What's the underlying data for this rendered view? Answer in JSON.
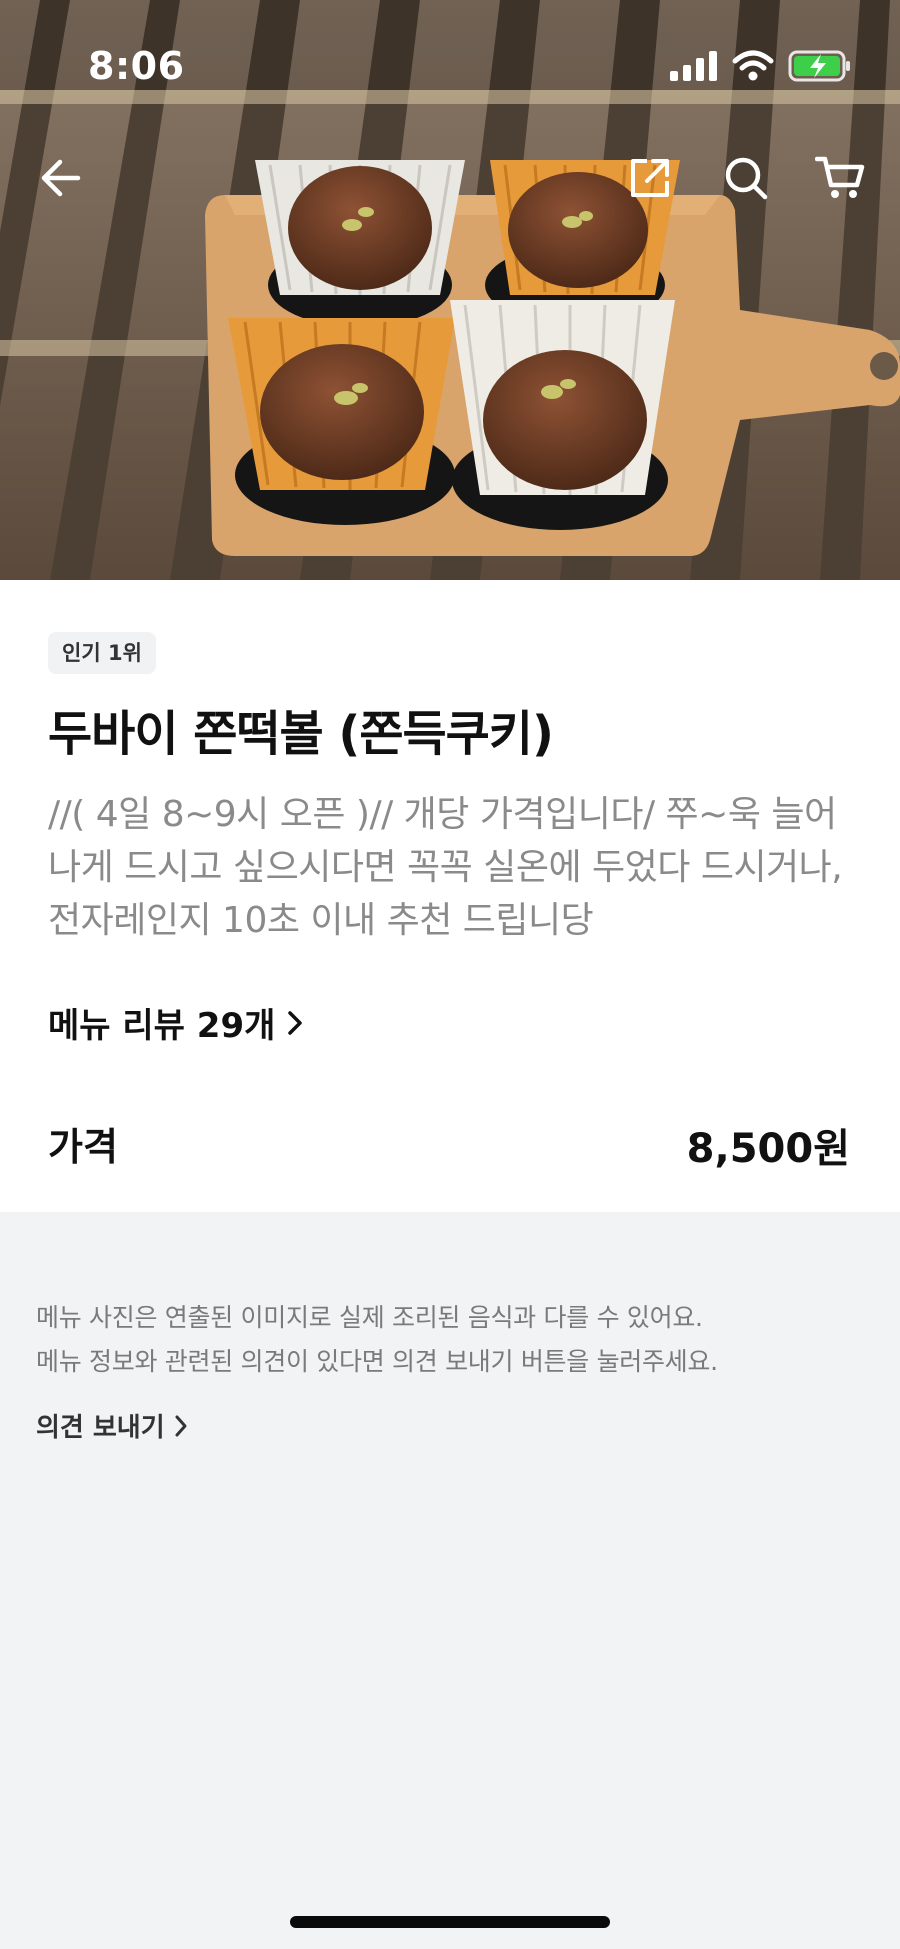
{
  "status_bar": {
    "time": "8:06"
  },
  "product": {
    "badge": "인기 1위",
    "title": "두바이 쫀떡볼 (쫀득쿠키)",
    "description_lines": [
      "//( 4일 8~9시 오픈 )// 개당 가격입니다/ 쭈~욱 늘어",
      "나게 드시고 싶으시다면 꼭꼭 실온에 두었다 드시거나,",
      " 전자레인지 10초 이내 추천 드립니당"
    ],
    "reviews_label": "메뉴 리뷰 29개",
    "price_label": "가격",
    "price_value": "8,500원"
  },
  "notice": {
    "lines": [
      "메뉴 사진은 연출된 이미지로 실제 조리된 음식과 다를 수 있어요.",
      "메뉴 정보와 관련된 의견이 있다면 의견 보내기 버튼을 눌러주세요."
    ],
    "feedback_label": "의견 보내기"
  },
  "icons": {
    "back": "arrow-left-icon",
    "share": "share-icon",
    "search": "search-icon",
    "cart": "cart-icon",
    "chevron": "chevron-right-icon"
  },
  "colors": {
    "battery_fill": "#3ecf4a",
    "description_text": "#8a8a8a",
    "page_background": "#f2f3f5"
  }
}
